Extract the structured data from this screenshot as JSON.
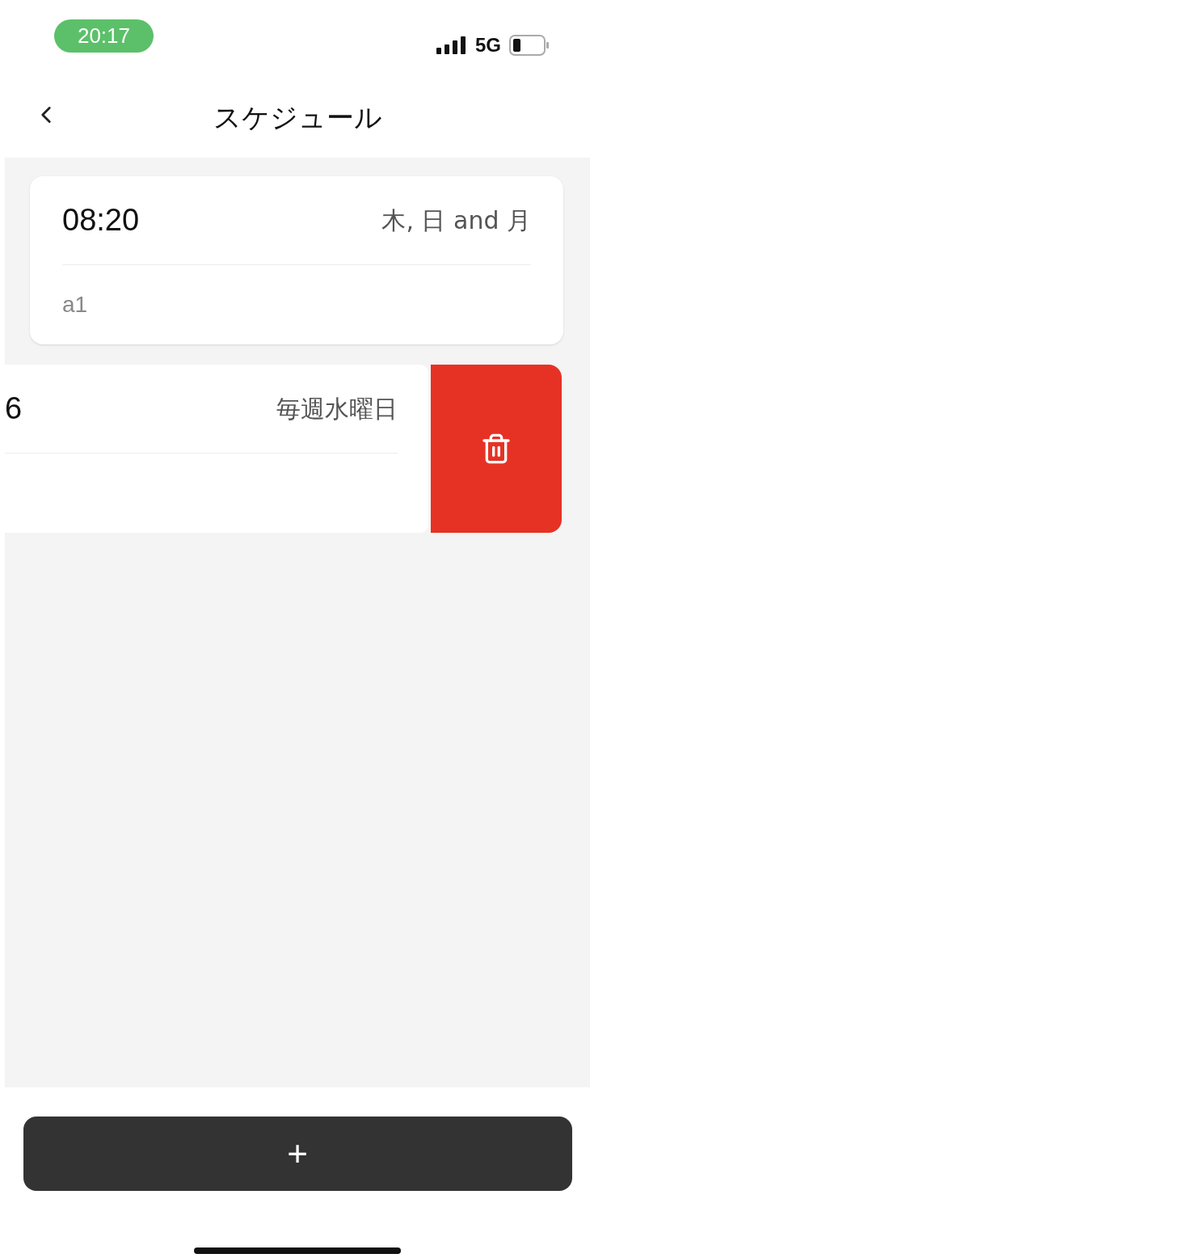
{
  "status_bar": {
    "time": "20:17",
    "network": "5G"
  },
  "header": {
    "title": "スケジュール"
  },
  "schedules": [
    {
      "time": "08:20",
      "days": "木, 日 and 月",
      "name": "a1",
      "swiped": false
    },
    {
      "time": "6",
      "days": "毎週水曜日",
      "swiped": true
    }
  ],
  "add_button": {
    "label": "+"
  }
}
